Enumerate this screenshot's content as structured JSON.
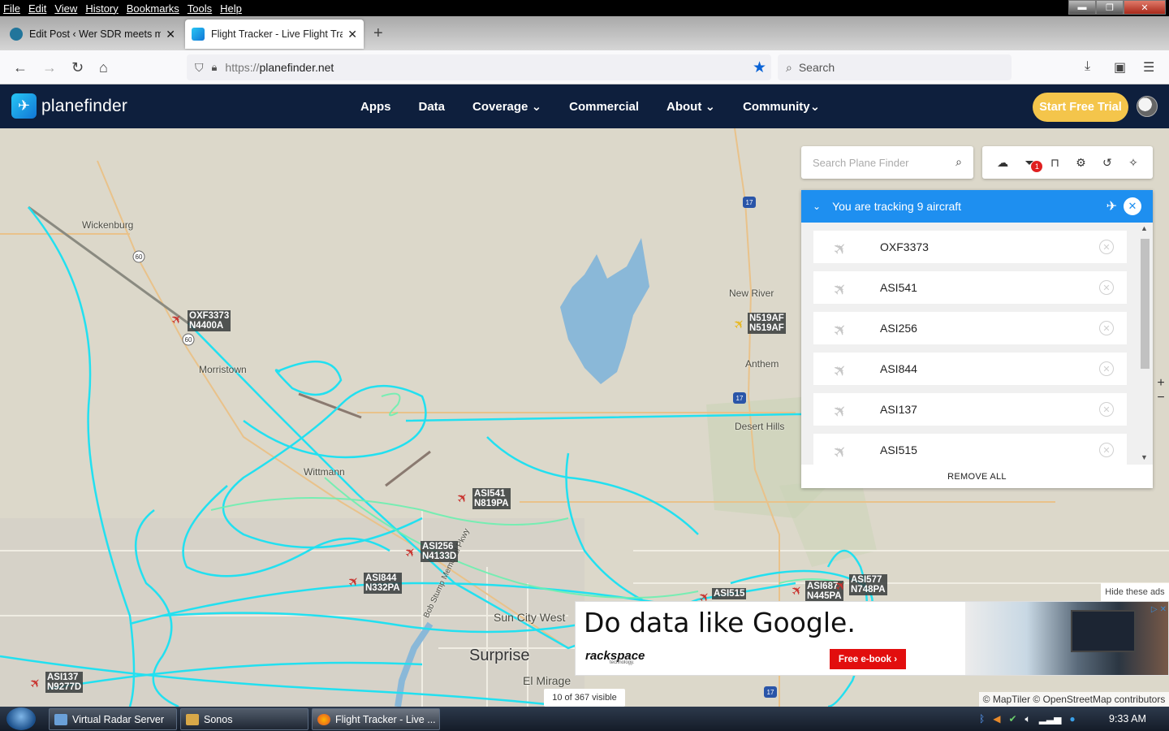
{
  "menu": [
    "File",
    "Edit",
    "View",
    "History",
    "Bookmarks",
    "Tools",
    "Help"
  ],
  "tabs": [
    {
      "title": "Edit Post ‹ Wer SDR meets micro",
      "active": false
    },
    {
      "title": "Flight Tracker - Live Flight Track",
      "active": true
    }
  ],
  "nav": {
    "url_proto": "https://",
    "url_host": "planefinder.net",
    "search_placeholder": "Search"
  },
  "site": {
    "logo_text": "planefinder",
    "nav": [
      {
        "label": "Apps",
        "dropdown": false
      },
      {
        "label": "Data",
        "dropdown": false
      },
      {
        "label": "Coverage",
        "dropdown": true
      },
      {
        "label": "Commercial",
        "dropdown": false
      },
      {
        "label": "About",
        "dropdown": true
      },
      {
        "label": "Community",
        "dropdown": true
      }
    ],
    "cta": "Start Free Trial"
  },
  "map": {
    "search_placeholder": "Search Plane Finder",
    "filter_badge": "1",
    "places": [
      {
        "name": "Wickenburg"
      },
      {
        "name": "Morristown"
      },
      {
        "name": "Wittmann"
      },
      {
        "name": "New River"
      },
      {
        "name": "Anthem"
      },
      {
        "name": "Desert Hills"
      },
      {
        "name": "Sun City West"
      },
      {
        "name": "Surprise"
      },
      {
        "name": "El Mirage"
      },
      {
        "name": "Bob Stump Memorial Pkwy"
      }
    ],
    "road_shields": [
      "60",
      "60",
      "17",
      "17",
      "17"
    ],
    "aircraft": [
      {
        "callsign": "OXF3373",
        "reg": "N4400A"
      },
      {
        "callsign": "N519AF",
        "reg": "N519AF"
      },
      {
        "callsign": "ASI541",
        "reg": "N819PA"
      },
      {
        "callsign": "ASI256",
        "reg": "N4133D"
      },
      {
        "callsign": "ASI844",
        "reg": "N332PA"
      },
      {
        "callsign": "ASI137",
        "reg": "N9277D"
      },
      {
        "callsign": "ASI515",
        "reg": ""
      },
      {
        "callsign": "ASI687",
        "reg": "N445PA"
      },
      {
        "callsign": "ASI577",
        "reg": "N748PA"
      }
    ],
    "visible_count": "10 of 367 visible",
    "attribution": "© MapTiler © OpenStreetMap contributors"
  },
  "tracking": {
    "title": "You are tracking 9 aircraft",
    "items": [
      "OXF3373",
      "ASI541",
      "ASI256",
      "ASI844",
      "ASI137",
      "ASI515"
    ],
    "remove_all": "REMOVE ALL"
  },
  "ad": {
    "hide_label": "Hide these ads",
    "headline": "Do data like Google.",
    "brand": "rackspace",
    "brand_sub": "technology.",
    "cta": "Free e-book ›"
  },
  "taskbar": {
    "buttons": [
      "Virtual Radar Server",
      "Sonos",
      "Flight Tracker - Live ..."
    ],
    "clock": "9:33 AM"
  },
  "colors": {
    "header": "#0e1f3d",
    "accent": "#1e8ff0",
    "trial": "#f4c54b",
    "track": "#22e0f0"
  }
}
